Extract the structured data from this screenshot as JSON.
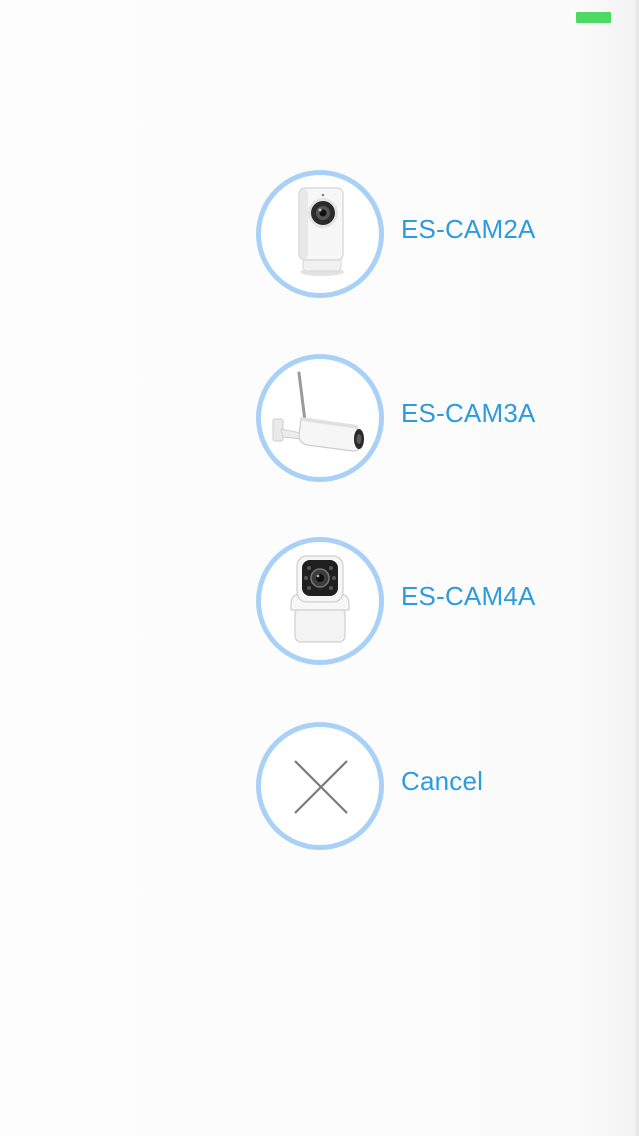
{
  "status_bar": {
    "battery_color": "#4cd964"
  },
  "options": [
    {
      "label": "ES-CAM2A",
      "icon": "cube-camera-icon"
    },
    {
      "label": "ES-CAM3A",
      "icon": "bullet-camera-icon"
    },
    {
      "label": "ES-CAM4A",
      "icon": "pan-tilt-camera-icon"
    },
    {
      "label": "Cancel",
      "icon": "close-icon"
    }
  ],
  "colors": {
    "accent": "#2c9be0",
    "ring": "#a9d1f7",
    "background": "#fcfcfc"
  }
}
